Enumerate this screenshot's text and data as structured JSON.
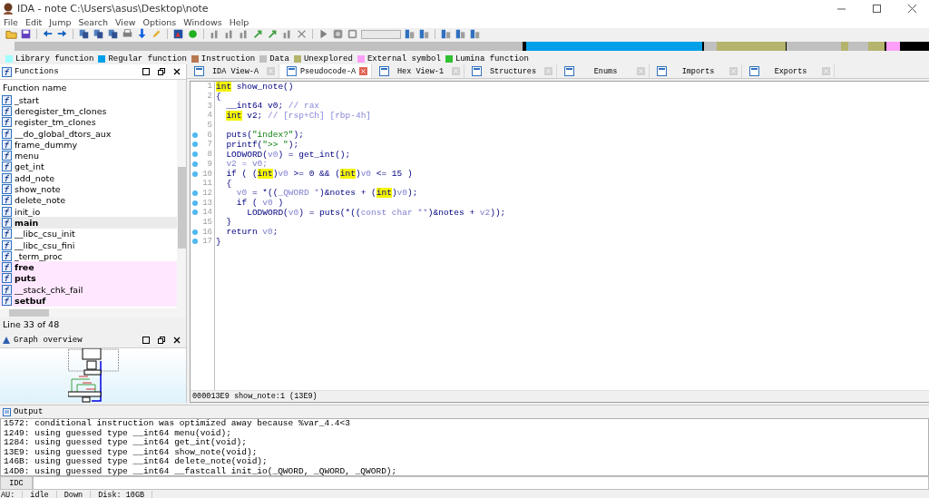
{
  "window": {
    "title": "IDA - note C:\\Users\\asus\\Desktop\\note"
  },
  "menu": [
    "File",
    "Edit",
    "Jump",
    "Search",
    "View",
    "Options",
    "Windows",
    "Help"
  ],
  "legend": [
    {
      "label": "Library function",
      "color": "#a0ffff"
    },
    {
      "label": "Regular function",
      "color": "#00a0e8"
    },
    {
      "label": "Instruction",
      "color": "#b87850"
    },
    {
      "label": "Data",
      "color": "#c0c0c0"
    },
    {
      "label": "Unexplored",
      "color": "#b4b46c"
    },
    {
      "label": "External symbol",
      "color": "#ffa0f8"
    },
    {
      "label": "Lumina function",
      "color": "#30c030"
    }
  ],
  "functions": {
    "title": "Functions",
    "column": "Function name",
    "status": "Line 33 of 48",
    "items": [
      {
        "name": "_start",
        "kind": "regular",
        "bold": false,
        "selected": false
      },
      {
        "name": "deregister_tm_clones",
        "kind": "regular",
        "bold": false,
        "selected": false
      },
      {
        "name": "register_tm_clones",
        "kind": "regular",
        "bold": false,
        "selected": false
      },
      {
        "name": "__do_global_dtors_aux",
        "kind": "regular",
        "bold": false,
        "selected": false
      },
      {
        "name": "frame_dummy",
        "kind": "regular",
        "bold": false,
        "selected": false
      },
      {
        "name": "menu",
        "kind": "regular",
        "bold": false,
        "selected": false
      },
      {
        "name": "get_int",
        "kind": "regular",
        "bold": false,
        "selected": false
      },
      {
        "name": "add_note",
        "kind": "regular",
        "bold": false,
        "selected": false
      },
      {
        "name": "show_note",
        "kind": "regular",
        "bold": false,
        "selected": false
      },
      {
        "name": "delete_note",
        "kind": "regular",
        "bold": false,
        "selected": false
      },
      {
        "name": "init_io",
        "kind": "regular",
        "bold": false,
        "selected": false
      },
      {
        "name": "main",
        "kind": "regular",
        "bold": true,
        "selected": true
      },
      {
        "name": "__libc_csu_init",
        "kind": "regular",
        "bold": false,
        "selected": false
      },
      {
        "name": "__libc_csu_fini",
        "kind": "regular",
        "bold": false,
        "selected": false
      },
      {
        "name": "_term_proc",
        "kind": "regular",
        "bold": false,
        "selected": false
      },
      {
        "name": "free",
        "kind": "import",
        "bold": true,
        "selected": false
      },
      {
        "name": "puts",
        "kind": "import",
        "bold": true,
        "selected": false
      },
      {
        "name": "__stack_chk_fail",
        "kind": "import",
        "bold": false,
        "selected": false
      },
      {
        "name": "setbuf",
        "kind": "import",
        "bold": true,
        "selected": false
      }
    ]
  },
  "graph_overview": {
    "title": "Graph overview"
  },
  "tabs": [
    {
      "label": "IDA View-A",
      "selected": false
    },
    {
      "label": "Pseudocode-A",
      "selected": true
    },
    {
      "label": "Hex View-1",
      "selected": false
    },
    {
      "label": "Structures",
      "selected": false
    },
    {
      "label": "Enums",
      "selected": false
    },
    {
      "label": "Imports",
      "selected": false
    },
    {
      "label": "Exports",
      "selected": false
    }
  ],
  "code": {
    "status": "000013E9 show_note:1 (13E9)",
    "lines": [
      {
        "n": "1",
        "bp": false,
        "tokens": [
          {
            "t": "int",
            "kind": "hl"
          },
          {
            "t": " show_note()",
            "kind": "code"
          }
        ]
      },
      {
        "n": "2",
        "bp": false,
        "tokens": [
          {
            "t": "{",
            "kind": "code"
          }
        ]
      },
      {
        "n": "3",
        "bp": false,
        "tokens": [
          {
            "t": "  __int64 v0; ",
            "kind": "code"
          },
          {
            "t": "// rax",
            "kind": "cmt"
          }
        ]
      },
      {
        "n": "4",
        "bp": false,
        "tokens": [
          {
            "t": "  int",
            "kind": "hl"
          },
          {
            "t": " v2; ",
            "kind": "code"
          },
          {
            "t": "// [rsp+Ch] [rbp-4h]",
            "kind": "cmt"
          }
        ]
      },
      {
        "n": "5",
        "bp": false
      },
      {
        "n": "6",
        "bp": true,
        "tokens": [
          {
            "t": "  puts(",
            "kind": "code"
          },
          {
            "t": "\"index?\"",
            "kind": "str"
          },
          {
            "t": ");",
            "kind": "code"
          }
        ]
      },
      {
        "n": "7",
        "bp": true,
        "tokens": [
          {
            "t": "  printf(",
            "kind": "code"
          },
          {
            "t": "\">> \"",
            "kind": "str"
          },
          {
            "t": ");",
            "kind": "code"
          }
        ]
      },
      {
        "n": "8",
        "bp": true,
        "tokens": [
          {
            "t": "  LODWORD(",
            "kind": "code"
          },
          {
            "t": "v0",
            "kind": "var"
          },
          {
            "t": ") = get_int();",
            "kind": "code"
          }
        ]
      },
      {
        "n": "9",
        "bp": true,
        "tokens": [
          {
            "t": "  v2 = v0;",
            "kind": "var"
          }
        ]
      },
      {
        "n": "10",
        "bp": true,
        "tokens": [
          {
            "t": "  if ( (",
            "kind": "code"
          },
          {
            "t": "int",
            "kind": "hl"
          },
          {
            "t": ")",
            "kind": "code"
          },
          {
            "t": "v0",
            "kind": "var"
          },
          {
            "t": " >= 0 && (",
            "kind": "code"
          },
          {
            "t": "int",
            "kind": "hl"
          },
          {
            "t": ")",
            "kind": "code"
          },
          {
            "t": "v0",
            "kind": "var"
          },
          {
            "t": " <= 15 )",
            "kind": "code"
          }
        ]
      },
      {
        "n": "11",
        "bp": false,
        "tokens": [
          {
            "t": "  {",
            "kind": "code"
          }
        ]
      },
      {
        "n": "12",
        "bp": true,
        "tokens": [
          {
            "t": "    v0",
            "kind": "var"
          },
          {
            "t": " = *((",
            "kind": "code"
          },
          {
            "t": "_QWORD *",
            "kind": "var"
          },
          {
            "t": ")&notes + (",
            "kind": "code"
          },
          {
            "t": "int",
            "kind": "hl"
          },
          {
            "t": ")",
            "kind": "code"
          },
          {
            "t": "v0",
            "kind": "var"
          },
          {
            "t": ");",
            "kind": "code"
          }
        ]
      },
      {
        "n": "13",
        "bp": true,
        "tokens": [
          {
            "t": "    if ( ",
            "kind": "code"
          },
          {
            "t": "v0",
            "kind": "var"
          },
          {
            "t": " )",
            "kind": "code"
          }
        ]
      },
      {
        "n": "14",
        "bp": true,
        "tokens": [
          {
            "t": "      LODWORD(",
            "kind": "code"
          },
          {
            "t": "v0",
            "kind": "var"
          },
          {
            "t": ") = puts(*((",
            "kind": "code"
          },
          {
            "t": "const char **",
            "kind": "var"
          },
          {
            "t": ")&notes + ",
            "kind": "code"
          },
          {
            "t": "v2",
            "kind": "var"
          },
          {
            "t": "));",
            "kind": "code"
          }
        ]
      },
      {
        "n": "15",
        "bp": false,
        "tokens": [
          {
            "t": "  }",
            "kind": "code"
          }
        ]
      },
      {
        "n": "16",
        "bp": true,
        "tokens": [
          {
            "t": "  return ",
            "kind": "code"
          },
          {
            "t": "v0",
            "kind": "var"
          },
          {
            "t": ";",
            "kind": "code"
          }
        ]
      },
      {
        "n": "17",
        "bp": true,
        "tokens": [
          {
            "t": "}",
            "kind": "code"
          }
        ]
      }
    ]
  },
  "output": {
    "title": "Output",
    "lines": [
      "1572: conditional instruction was optimized away because %var_4.4<3",
      "1249: using guessed type __int64 menu(void);",
      "1284: using guessed type __int64 get_int(void);",
      "13E9: using guessed type __int64 show_note(void);",
      "146B: using guessed type __int64 delete_note(void);",
      "14D0: using guessed type __int64 __fastcall init_io(_QWORD, _QWORD, _QWORD);"
    ],
    "idc_button": "IDC"
  },
  "status_bar": [
    "AU:",
    "idle",
    "Down",
    "Disk: 10GB"
  ]
}
